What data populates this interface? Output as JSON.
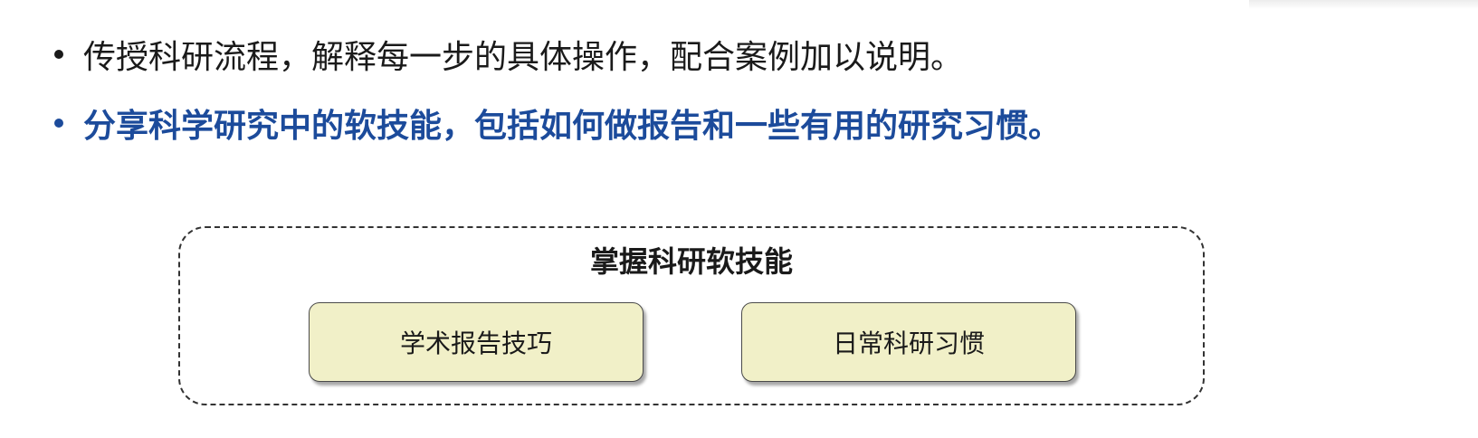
{
  "bullets": [
    {
      "text": "传授科研流程，解释每一步的具体操作，配合案例加以说明。",
      "style": "plain",
      "color": "#1a1a1a"
    },
    {
      "text": "分享科学研究中的软技能，包括如何做报告和一些有用的研究习惯。",
      "style": "highlight",
      "color": "#1c4b9b"
    }
  ],
  "diagram": {
    "title": "掌握科研软技能",
    "boxes": [
      {
        "label": "学术报告技巧"
      },
      {
        "label": "日常科研习惯"
      }
    ],
    "box_fill": "#f1f0c8"
  }
}
